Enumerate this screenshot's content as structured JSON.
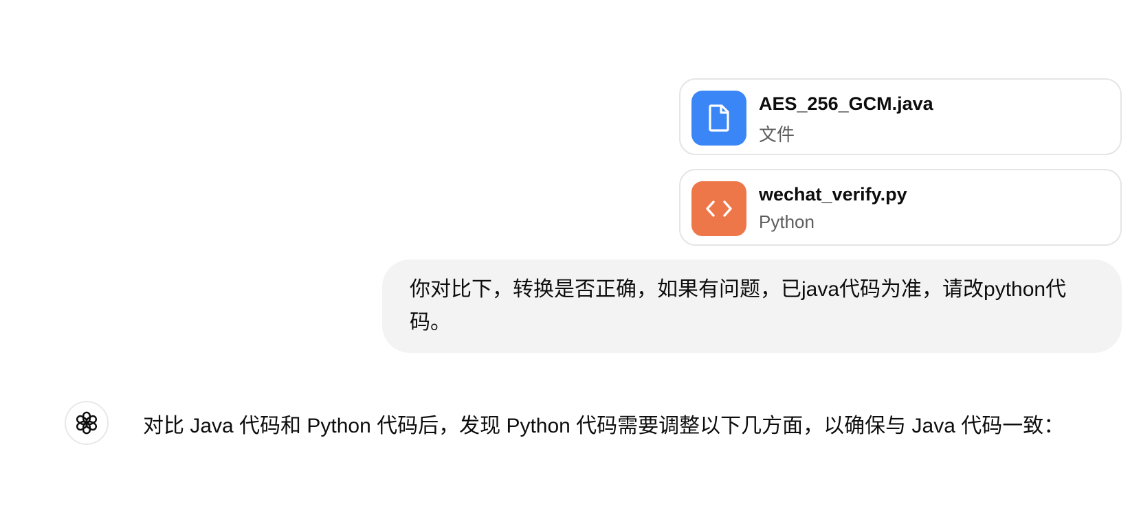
{
  "attachments": [
    {
      "name": "AES_256_GCM.java",
      "type": "文件",
      "icon": "document-icon",
      "color": "#3b86f7"
    },
    {
      "name": "wechat_verify.py",
      "type": "Python",
      "icon": "code-icon",
      "color": "#ee774a"
    }
  ],
  "user_message": "你对比下，转换是否正确，如果有问题，已java代码为准，请改python代码。",
  "assistant": {
    "avatar_icon": "openai-logo-icon",
    "message": "对比 Java 代码和 Python 代码后，发现 Python 代码需要调整以下几方面，以确保与 Java 代码一致："
  }
}
